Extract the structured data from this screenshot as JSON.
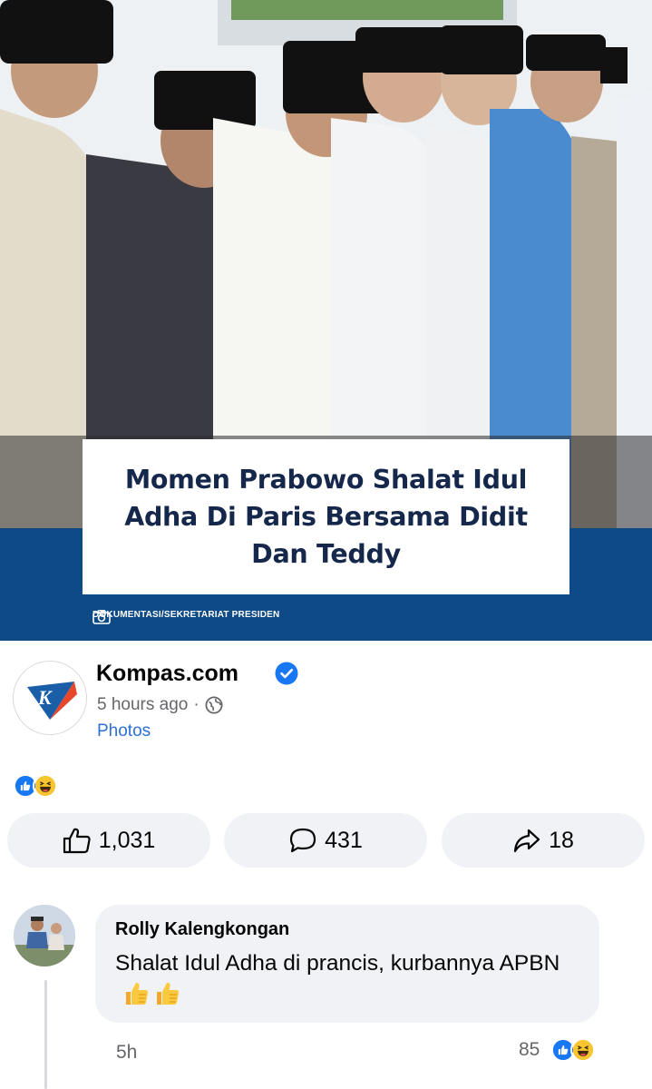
{
  "photo": {
    "headline": "Momen Prabowo Shalat Idul Adha Di Paris Bersama Didit Dan Teddy",
    "credit": "DOKUMENTASI/SEKRETARIAT PRESIDEN",
    "band_color": "#0d4a86",
    "headline_color": "#15284b"
  },
  "post": {
    "page_name": "Kompas.com",
    "logo_letter": "K",
    "verified": true,
    "time": "5 hours ago",
    "separator": "·",
    "audience_icon": "globe-icon",
    "attachment_label": "Photos",
    "reactions": [
      "like",
      "haha"
    ]
  },
  "actions": {
    "like_count": "1,031",
    "comment_count": "431",
    "share_count": "18"
  },
  "comment": {
    "author": "Rolly Kalengkongan",
    "text": "Shalat Idul Adha di prancis, kurbannya APBN",
    "emojis": [
      "thumbs-up",
      "thumbs-up"
    ],
    "time": "5h",
    "reaction_count": "85",
    "reactions": [
      "like",
      "haha"
    ]
  },
  "colors": {
    "link_blue": "#2d6fd7",
    "verified_blue": "#1877f2",
    "pill_bg": "#f0f2f5",
    "secondary_text": "#65676b"
  }
}
